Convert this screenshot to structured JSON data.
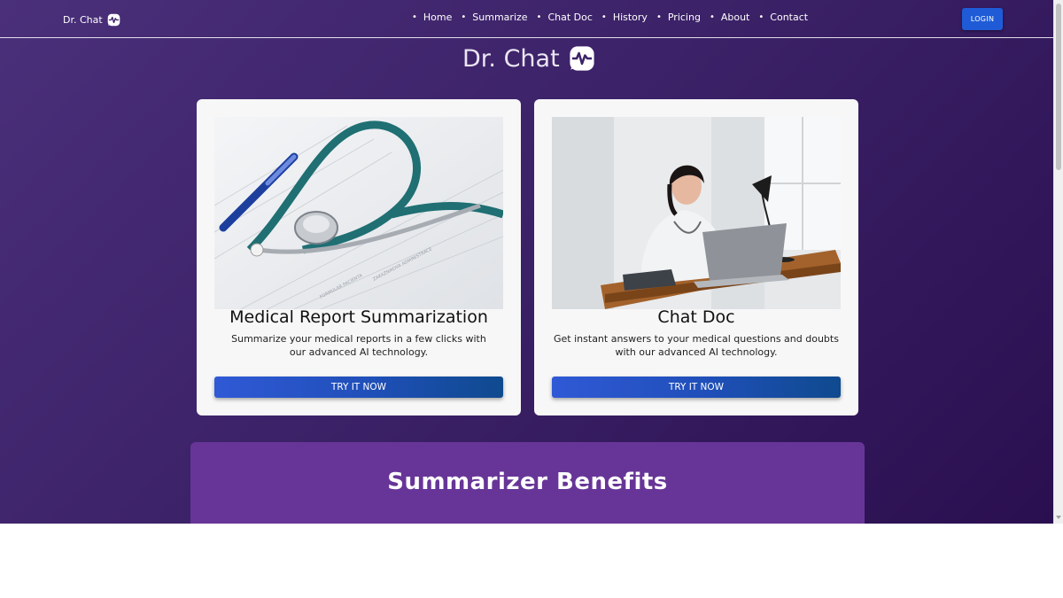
{
  "navbar": {
    "brand": "Dr. Chat",
    "brand_icon": "heartbeat-chat-icon",
    "links": [
      "Home",
      "Summarize",
      "Chat Doc",
      "History",
      "Pricing",
      "About",
      "Contact"
    ],
    "login_label": "LOGIN"
  },
  "hero": {
    "title": "Dr. Chat",
    "icon": "heartbeat-chat-icon"
  },
  "cards": [
    {
      "title": "Medical Report Summarization",
      "description": "Summarize your medical reports in a few clicks with our advanced AI technology.",
      "button_label": "TRY IT NOW",
      "image": "stethoscope-on-medical-report-photo"
    },
    {
      "title": "Chat Doc",
      "description": "Get instant answers to your medical questions and doubts with our advanced AI technology.",
      "button_label": "TRY IT NOW",
      "image": "doctor-at-laptop-photo"
    }
  ],
  "benefits": {
    "title": "Summarizer Benefits"
  },
  "colors": {
    "background_gradient_start": "#4a2f7a",
    "background_gradient_end": "#2a0f50",
    "login_button": "#1f5bd6",
    "try_button": "#2a55c8",
    "benefits_panel": "#673597",
    "card_background": "#f7f7f8"
  }
}
